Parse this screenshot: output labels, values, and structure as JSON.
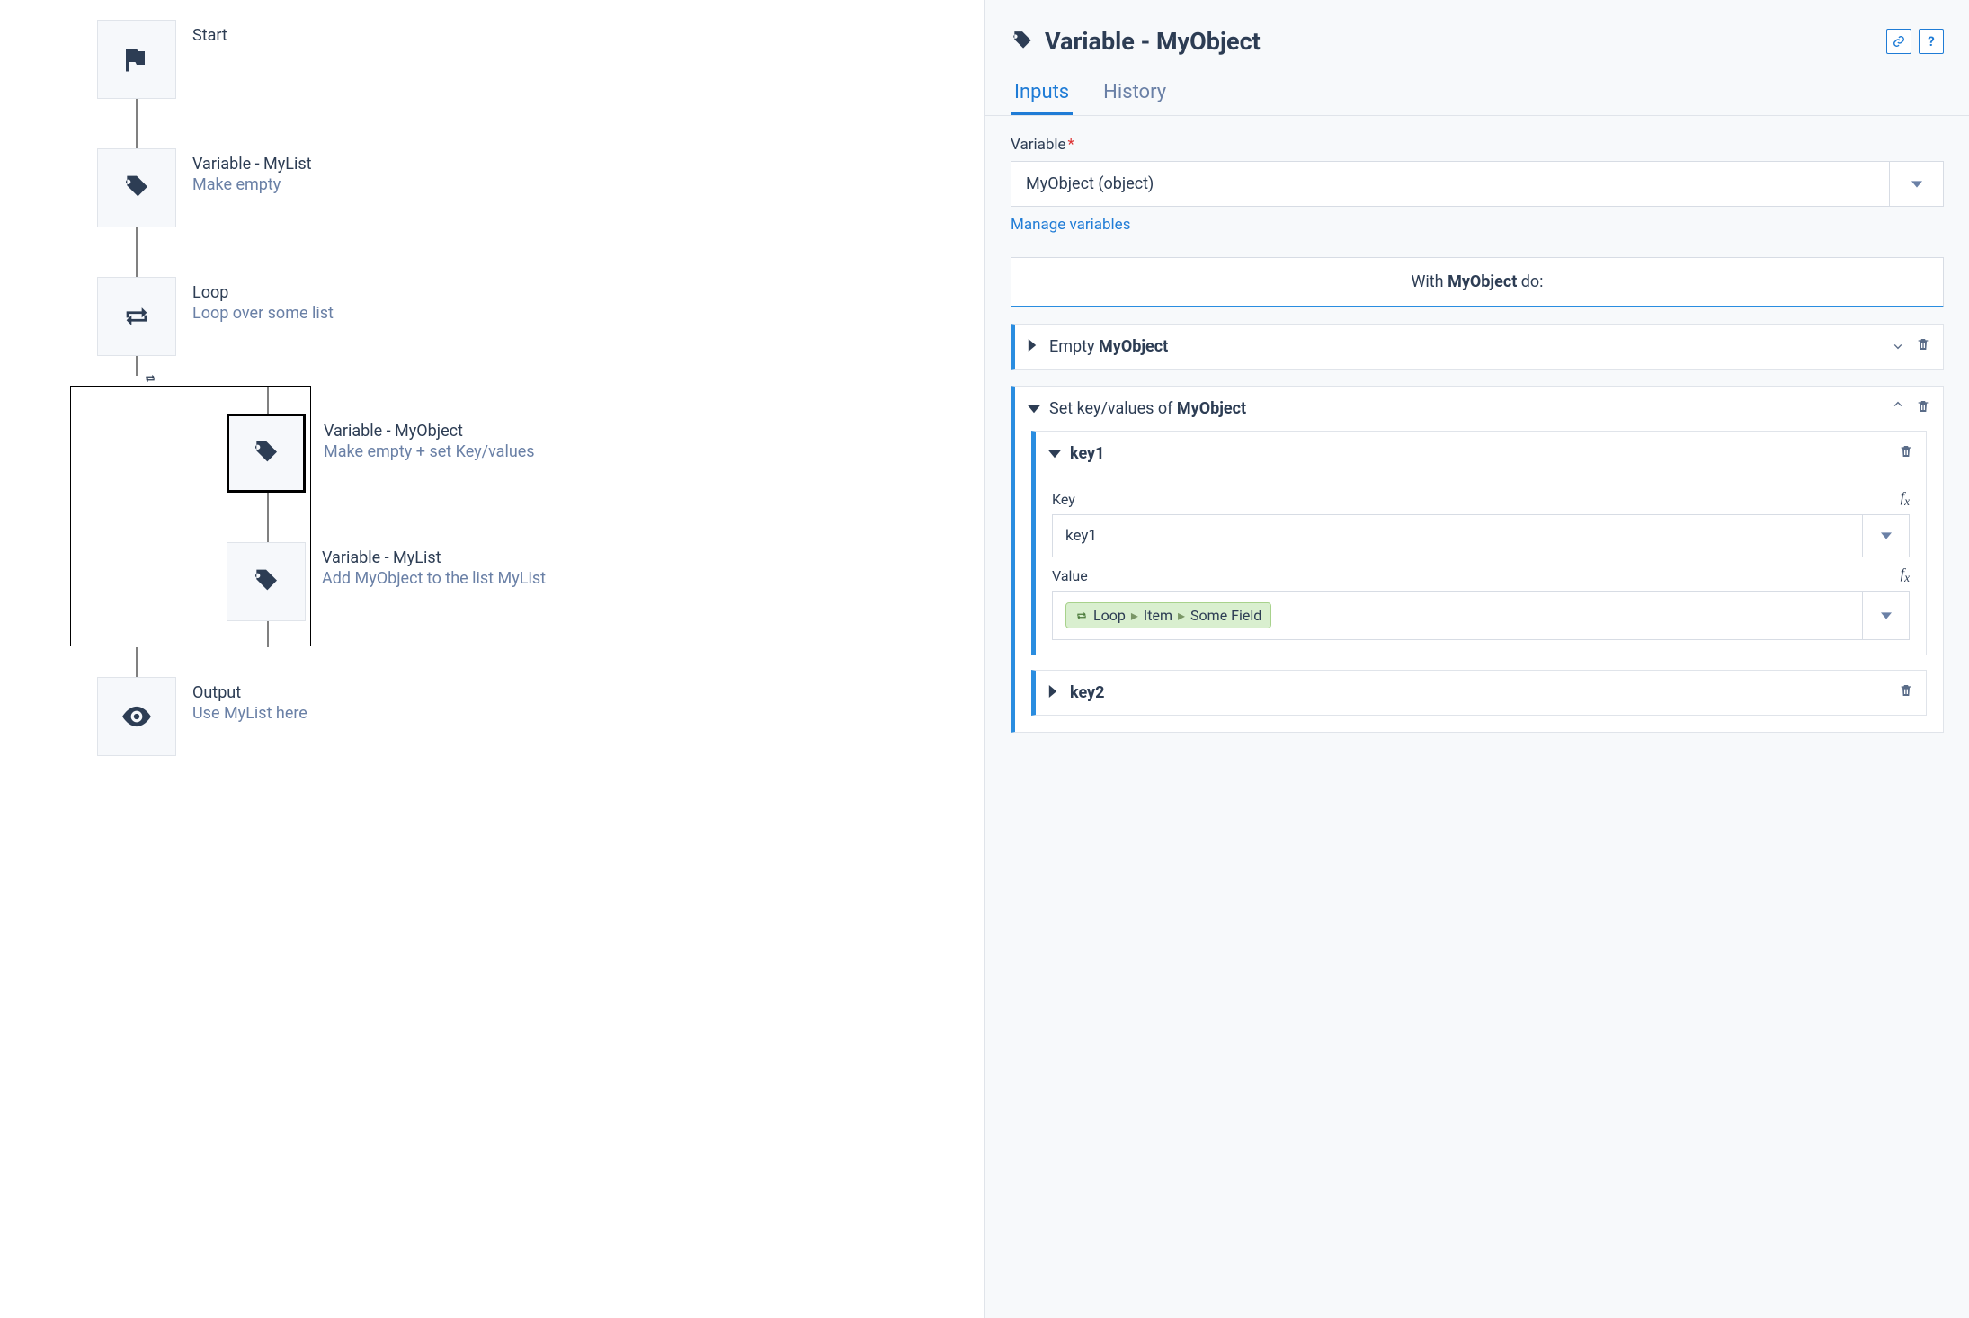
{
  "right": {
    "title": "Variable - MyObject",
    "tabs": {
      "inputs": "Inputs",
      "history": "History"
    },
    "variable_label": "Variable",
    "variable_value": "MyObject (object)",
    "manage_link": "Manage variables",
    "with_prefix": "With ",
    "with_obj": "MyObject",
    "with_suffix": " do:",
    "op_empty_prefix": "Empty ",
    "op_empty_obj": "MyObject",
    "op_set_prefix": "Set key/values of ",
    "op_set_obj": "MyObject",
    "key1": {
      "title": "key1",
      "key_label": "Key",
      "key_value": "key1",
      "value_label": "Value",
      "pill": {
        "a": "Loop",
        "b": "Item",
        "c": "Some Field"
      }
    },
    "key2": {
      "title": "key2"
    }
  },
  "flow": {
    "start": {
      "title": "Start"
    },
    "var_mylist": {
      "title": "Variable - MyList",
      "sub": "Make empty"
    },
    "loop": {
      "title": "Loop",
      "sub": "Loop over some list"
    },
    "var_myobject": {
      "title": "Variable - MyObject",
      "sub": "Make empty + set Key/values"
    },
    "var_mylist2": {
      "title": "Variable - MyList",
      "sub": "Add MyObject to the list MyList"
    },
    "output": {
      "title": "Output",
      "sub": "Use MyList here"
    }
  }
}
